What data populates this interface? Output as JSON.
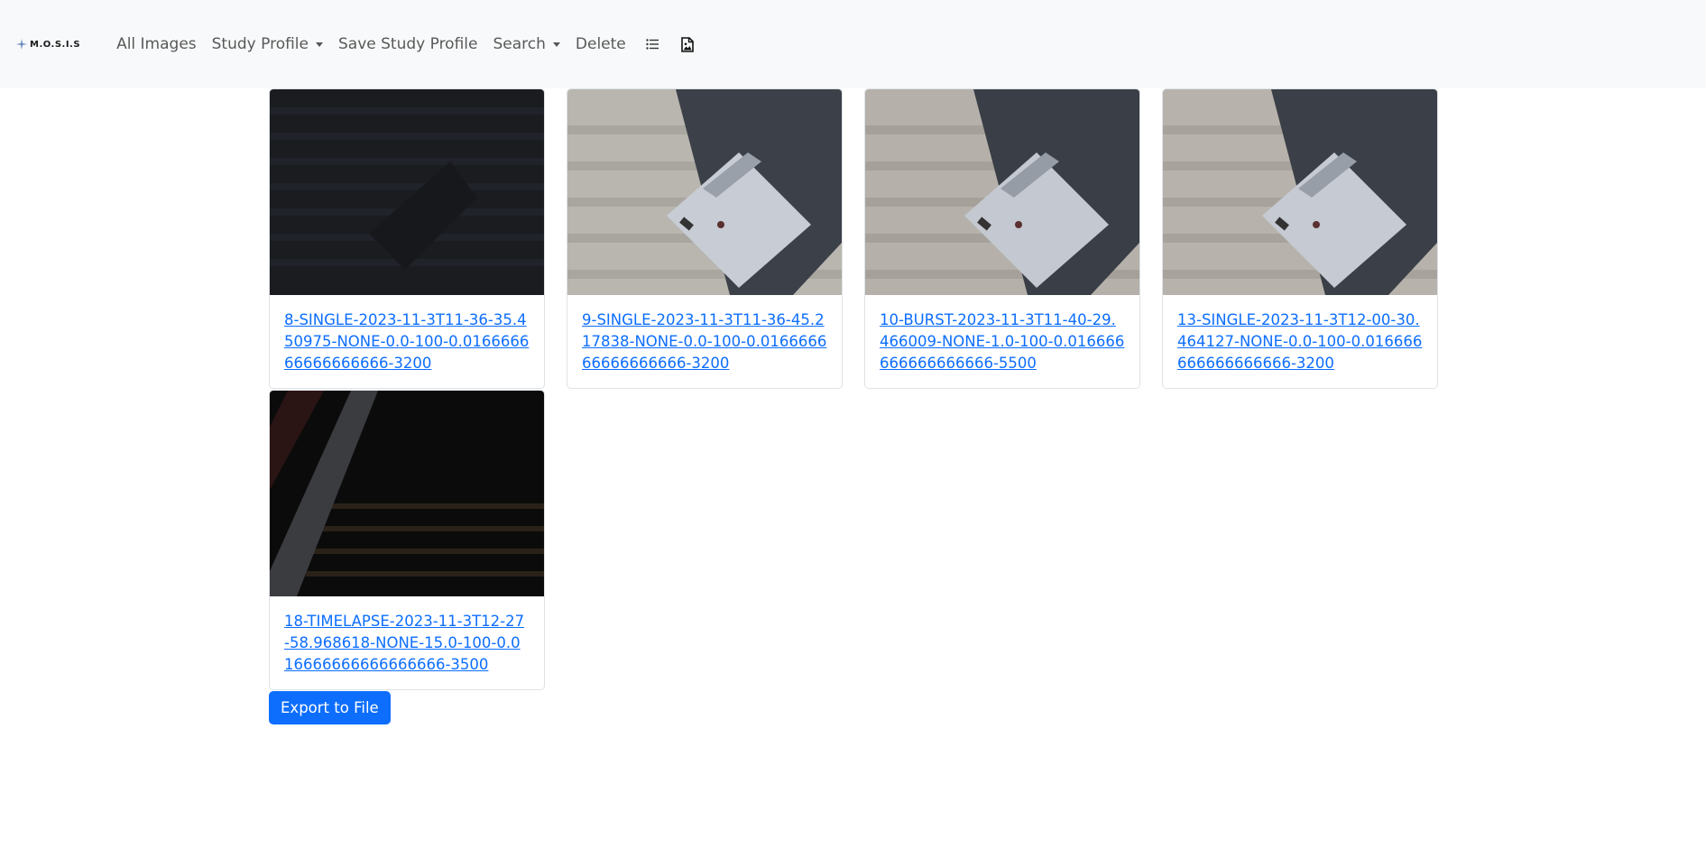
{
  "navbar": {
    "brand": "M.O.S.I.S",
    "items": [
      {
        "label": "All Images",
        "dropdown": false
      },
      {
        "label": "Study Profile",
        "dropdown": true
      },
      {
        "label": "Save Study Profile",
        "dropdown": false
      },
      {
        "label": "Search",
        "dropdown": true
      },
      {
        "label": "Delete",
        "dropdown": false
      }
    ],
    "icons": [
      "list-icon",
      "image-file-icon"
    ]
  },
  "images": [
    {
      "caption": "8-SINGLE-2023-11-3T11-36-35.450975-NONE-0.0-100-0.016666666666666666-3200",
      "thumbnail": "dark-image"
    },
    {
      "caption": "9-SINGLE-2023-11-3T11-36-45.217838-NONE-0.0-100-0.016666666666666666-3200",
      "thumbnail": "bright-image"
    },
    {
      "caption": "10-BURST-2023-11-3T11-40-29.466009-NONE-1.0-100-0.016666666666666666-5500",
      "thumbnail": "bright-image"
    },
    {
      "caption": "13-SINGLE-2023-11-3T12-00-30.464127-NONE-0.0-100-0.016666666666666666-3200",
      "thumbnail": "bright-image"
    },
    {
      "caption": "18-TIMELAPSE-2023-11-3T12-27-58.968618-NONE-15.0-100-0.016666666666666666-3500",
      "thumbnail": "dark-image"
    }
  ],
  "export_label": "Export to File",
  "colors": {
    "primary": "#0d6efd",
    "navbar_bg": "#f8f9fa",
    "card_border": "#dee2e6"
  }
}
